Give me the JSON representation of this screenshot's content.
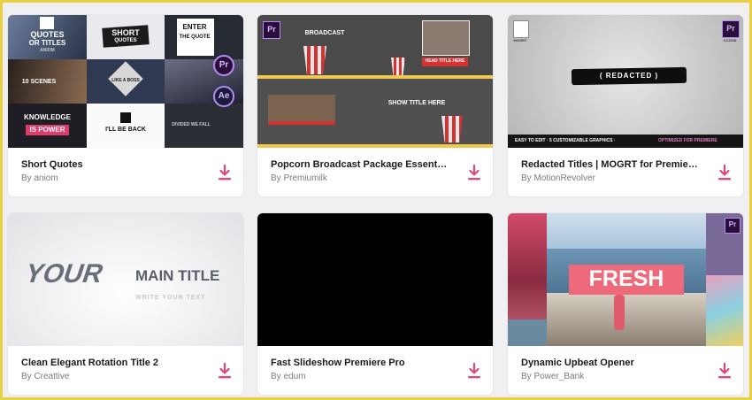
{
  "download_icon_color": "#e0457b",
  "cards": [
    {
      "title": "Short Quotes",
      "author": "By aniom",
      "thumb": {
        "t1_main": "QUOTES",
        "t1_sub": "OR TITLES",
        "t1_tag": "ANIOM",
        "t2_main": "SHORT",
        "t2_sub": "QUOTES",
        "t3_main": "ENTER",
        "t3_sub": "THE QUOTE",
        "t4_main": "10 SCENES",
        "t5_main": "LIKE A BOSS",
        "t7_main": "KNOWLEDGE",
        "t7_sub": "IS POWER",
        "t8_main": "I'LL BE BACK",
        "t9_main": "DIVIDED WE FALL",
        "pr_badge": "Pr",
        "ae_badge": "Ae"
      }
    },
    {
      "title": "Popcorn Broadcast Package Essential ...",
      "author": "By Premiumilk",
      "thumb": {
        "pr_badge": "Pr",
        "top_title": "BROADCAST",
        "lower_third": "HEAD TITLE HERE",
        "show_title": "SHOW TITLE HERE"
      }
    },
    {
      "title": "Redacted Titles | MOGRT for Premiere ...",
      "author": "By MotionRevolver",
      "thumb": {
        "mogrt_label": "MOGRT",
        "pr_badge": "Pr",
        "pr_version": "CC2018",
        "center_text": "( REDACTED )",
        "bottom_strip_left": "EASY TO EDIT · 5 CUSTOMIZABLE GRAPHICS ·",
        "bottom_strip_right": "OPTIMIZED FOR PREMIERE"
      }
    },
    {
      "title": "Clean Elegant Rotation Title 2",
      "author": "By Creattive",
      "thumb": {
        "headline_left": "YOUR",
        "headline_right": "MAIN TITLE",
        "subline": "WRITE YOUR TEXT"
      }
    },
    {
      "title": "Fast Slideshow Premiere Pro",
      "author": "By edum",
      "thumb": {}
    },
    {
      "title": "Dynamic Upbeat Opener",
      "author": "By Power_Bank",
      "thumb": {
        "banner_text": "FRESH",
        "pr_badge": "Pr"
      }
    }
  ]
}
